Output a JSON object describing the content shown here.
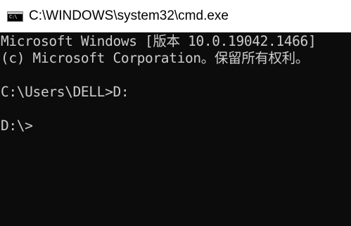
{
  "window": {
    "title": "C:\\WINDOWS\\system32\\cmd.exe",
    "icon_text": "C:\\",
    "icon_name": "cmd-icon"
  },
  "console": {
    "lines": [
      "Microsoft Windows [版本 10.0.19042.1466]",
      "(c) Microsoft Corporation。保留所有权利。",
      "C:\\Users\\DELL>D:",
      "D:\\>"
    ]
  },
  "colors": {
    "console_background": "#0c0c0c",
    "console_text": "#cccccc",
    "titlebar_background": "#ffffff"
  }
}
